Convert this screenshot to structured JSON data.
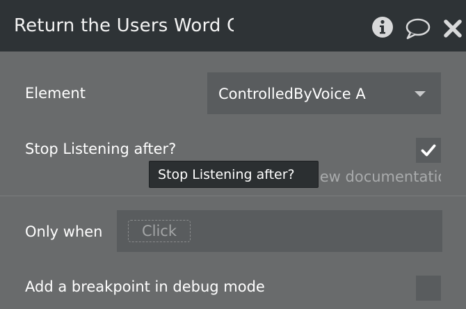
{
  "header": {
    "title": "Return the Users Word Country",
    "icons": [
      "info-icon",
      "comment-icon",
      "close-icon"
    ]
  },
  "fields": {
    "element": {
      "label": "Element",
      "value": "ControlledByVoice A"
    },
    "stop_listening": {
      "label": "Stop Listening after?",
      "checked": true,
      "doc_link": "View documentation",
      "tooltip": "Stop Listening after?"
    },
    "only_when": {
      "label": "Only when",
      "placeholder": "Click"
    },
    "breakpoint": {
      "label": "Add a breakpoint in debug mode",
      "checked": false
    }
  },
  "colors": {
    "header_bg": "#2e3336",
    "panel_bg": "#696b6c",
    "field_bg": "#595c5e"
  }
}
